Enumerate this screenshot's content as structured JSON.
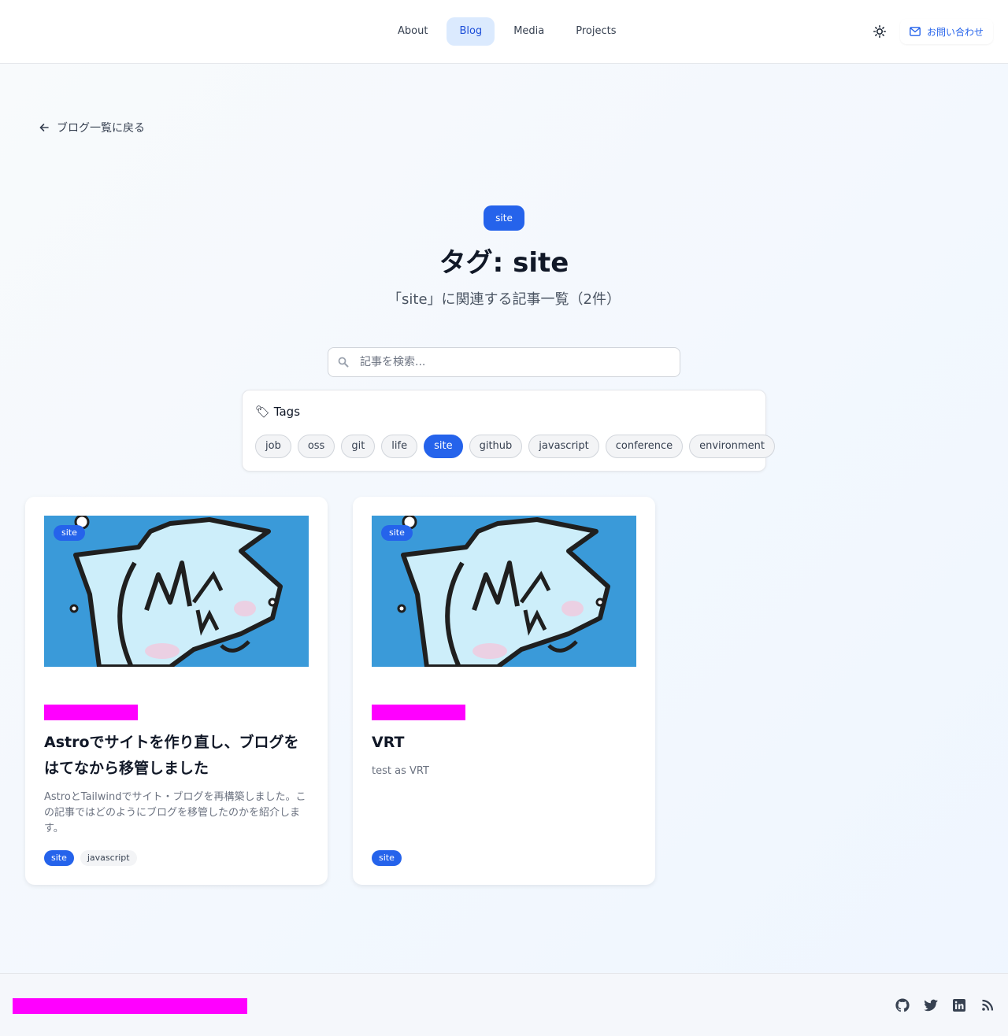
{
  "nav": {
    "items": [
      {
        "label": "About",
        "active": false
      },
      {
        "label": "Blog",
        "active": true
      },
      {
        "label": "Media",
        "active": false
      },
      {
        "label": "Projects",
        "active": false
      }
    ],
    "contact_label": "お問い合わせ",
    "theme_icon": "sun-icon"
  },
  "back_link": {
    "label": "ブログ一覧に戻る",
    "icon": "arrow-left-icon"
  },
  "hero": {
    "badge": "site",
    "title": "タグ: site",
    "subtitle": "「site」に関連する記事一覧（2件）"
  },
  "search": {
    "placeholder": "記事を検索...",
    "value": ""
  },
  "tags_panel": {
    "heading": "🏷 Tags",
    "tags": [
      "job",
      "oss",
      "git",
      "life",
      "site",
      "github",
      "javascript",
      "conference",
      "environment"
    ],
    "active": "site"
  },
  "posts": [
    {
      "image_badge": "site",
      "title": "Astroでサイトを作り直し、ブログをはてなから移管しました",
      "description": "AstroとTailwindでサイト・ブログを再構築しました。この記事ではどのようにブログを移管したのかを紹介します。",
      "tags": [
        "site",
        "javascript"
      ]
    },
    {
      "image_badge": "site",
      "title": "VRT",
      "description": "test as VRT",
      "tags": [
        "site"
      ]
    }
  ],
  "footer": {
    "social": [
      "github-icon",
      "twitter-icon",
      "linkedin-icon",
      "rss-icon"
    ]
  },
  "colors": {
    "accent": "#2563eb",
    "redacted": "#ff00ff",
    "image_bg": "#3a9ad9"
  }
}
